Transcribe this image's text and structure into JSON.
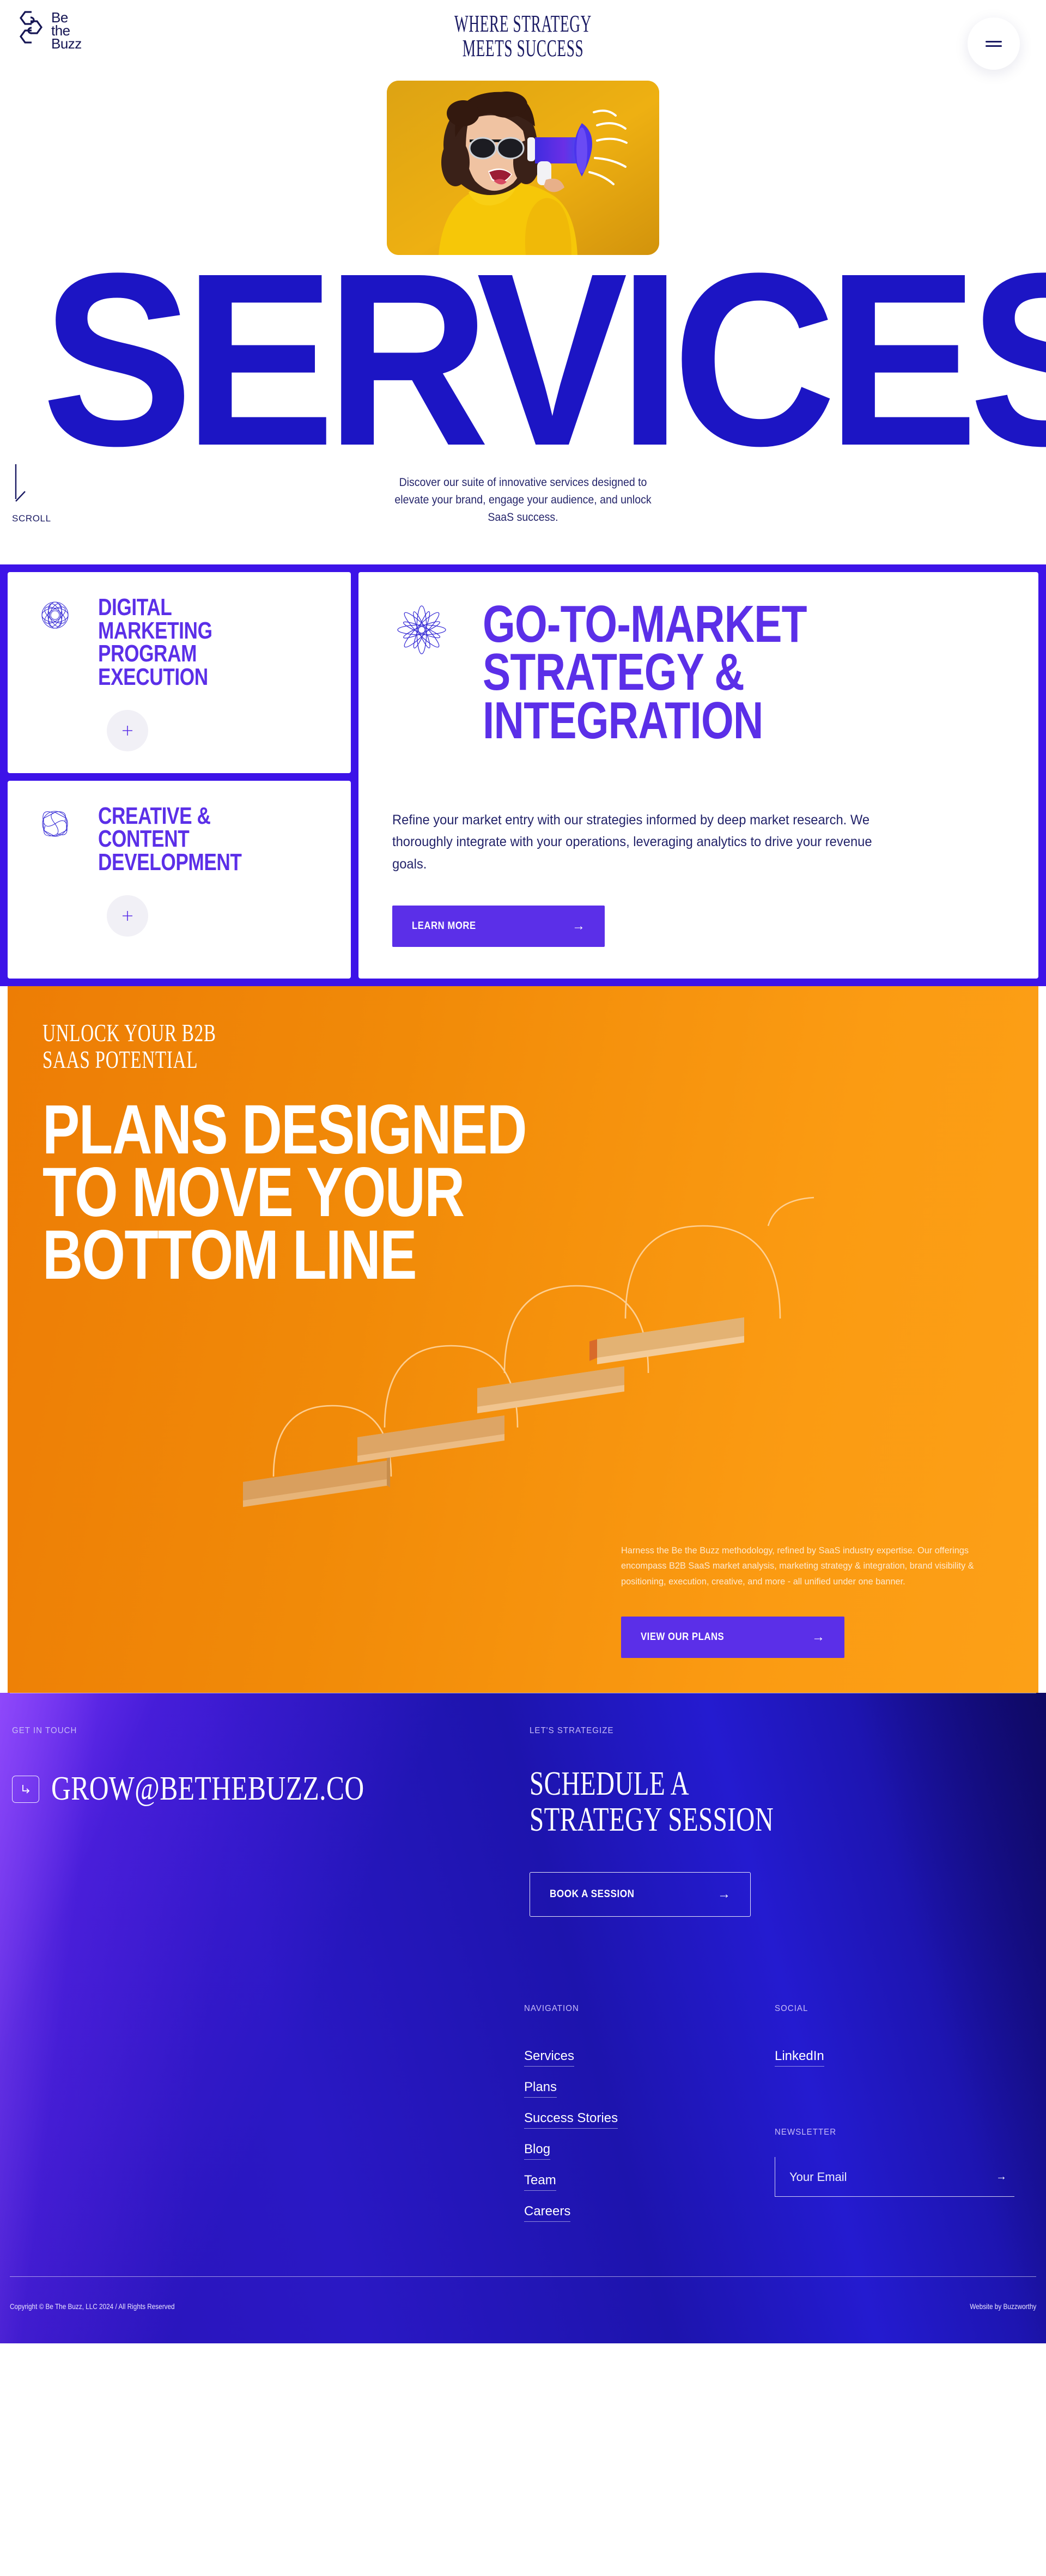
{
  "brand": {
    "logo_line1": "Be",
    "logo_line2": "the",
    "logo_line3": "Buzz",
    "logo_icon": "hexagon-bee-logo"
  },
  "header": {
    "eyebrow_line1": "WHERE STRATEGY",
    "eyebrow_line2": "MEETS SUCCESS",
    "menu_icon": "hamburger-menu-icon"
  },
  "hero": {
    "title": "SERVICES",
    "subtitle": "Discover our suite of innovative services designed to elevate your brand, engage your audience, and unlock SaaS success.",
    "scroll_label": "SCROLL",
    "scroll_icon": "arrow-down-icon",
    "photo_alt": "woman-with-megaphone-photo"
  },
  "services": {
    "accordion": [
      {
        "title": "DIGITAL MARKETING PROGRAM EXECUTION",
        "icon": "mandala-flower-icon",
        "expand_icon": "plus-icon"
      },
      {
        "title": "CREATIVE & CONTENT DEVELOPMENT",
        "icon": "swirl-flower-icon",
        "expand_icon": "plus-icon"
      }
    ],
    "active": {
      "icon": "petal-flower-icon",
      "title": "GO-TO-MARKET STRATEGY & INTEGRATION",
      "body": "Refine your market entry with our strategies informed by deep market research. We thoroughly integrate with your operations, leveraging analytics to drive your revenue goals.",
      "cta_label": "LEARN MORE",
      "cta_icon": "arrow-right-icon"
    }
  },
  "plans": {
    "eyebrow_line1": "UNLOCK YOUR B2B",
    "eyebrow_line2": "SAAS POTENTIAL",
    "title_line1": "PLANS DESIGNED",
    "title_line2": "TO MOVE YOUR",
    "title_line3": "BOTTOM LINE",
    "body": "Harness the Be the Buzz methodology, refined by SaaS industry expertise. Our offerings encompass B2B SaaS market analysis, marketing strategy & integration, brand visibility & positioning, execution, creative, and more - all unified under one banner.",
    "cta_label": "VIEW OUR PLANS",
    "cta_icon": "arrow-right-icon",
    "badge_icon": "two-stars-icon",
    "illustration": "wooden-stair-blocks-illustration"
  },
  "footer": {
    "contact_label": "GET IN TOUCH",
    "email": "GROW@BETHEBUZZ.CO",
    "email_icon": "arrow-corner-icon",
    "strategize_label": "LET'S STRATEGIZE",
    "schedule_line1": "SCHEDULE A",
    "schedule_line2": "STRATEGY SESSION",
    "book_label": "BOOK A SESSION",
    "book_icon": "arrow-right-icon",
    "nav_label": "NAVIGATION",
    "nav_items": [
      "Services",
      "Plans",
      "Success Stories",
      "Blog",
      "Team",
      "Careers"
    ],
    "social_label": "SOCIAL",
    "social_items": [
      "LinkedIn"
    ],
    "newsletter_label": "NEWSLETTER",
    "newsletter_placeholder": "Your Email",
    "newsletter_value": "",
    "newsletter_icon": "arrow-right-icon",
    "copyright": "Copyright © Be The Buzz, LLC 2024 / All Rights Reserved",
    "credit": "Website by Buzzworthy"
  },
  "colors": {
    "brand_navy": "#161654",
    "brand_blue": "#1c15c4",
    "accent_purple": "#5b2fe8",
    "accent_orange": "#f5900c",
    "panel_violet": "#3d13e8"
  }
}
